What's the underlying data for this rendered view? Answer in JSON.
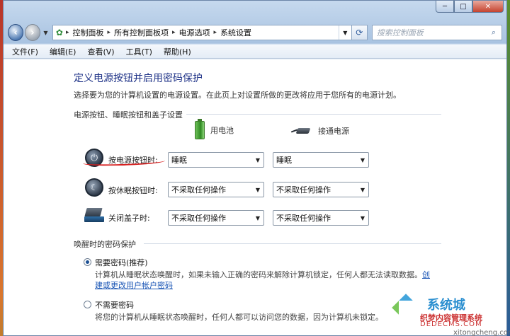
{
  "nav": {
    "breadcrumbs": [
      "控制面板",
      "所有控制面板项",
      "电源选项",
      "系统设置"
    ],
    "search_placeholder": "搜索控制面板"
  },
  "menu": [
    "文件(F)",
    "编辑(E)",
    "查看(V)",
    "工具(T)",
    "帮助(H)"
  ],
  "page": {
    "title": "定义电源按钮并启用密码保护",
    "description": "选择要为您的计算机设置的电源设置。在此页上对设置所做的更改将应用于您所有的电源计划。"
  },
  "buttons_section": {
    "heading": "电源按钮、睡眠按钮和盖子设置",
    "col_battery": "用电池",
    "col_plugged": "接通电源",
    "rows": [
      {
        "label": "按电源按钮时:",
        "battery": "睡眠",
        "plugged": "睡眠"
      },
      {
        "label": "按休眠按钮时:",
        "battery": "不采取任何操作",
        "plugged": "不采取任何操作"
      },
      {
        "label": "关闭盖子时:",
        "battery": "不采取任何操作",
        "plugged": "不采取任何操作"
      }
    ]
  },
  "password_section": {
    "heading": "唤醒时的密码保护",
    "options": [
      {
        "label": "需要密码(推荐)",
        "checked": true,
        "desc": "计算机从睡眠状态唤醒时，如果未输入正确的密码来解除计算机锁定，任何人都无法读取数据。",
        "link_start": "创",
        "link_rest": "建或更改用户帐户密码"
      },
      {
        "label": "不需要密码",
        "checked": false,
        "desc": "将您的计算机从睡眠状态唤醒时，任何人都可以访问您的数据，因为计算机未锁定。"
      }
    ]
  },
  "watermark": {
    "brand": "系统城",
    "sub": "xitongcheng.com",
    "cn": "织梦内容管理系统",
    "url": "DEDECMS.COM"
  }
}
